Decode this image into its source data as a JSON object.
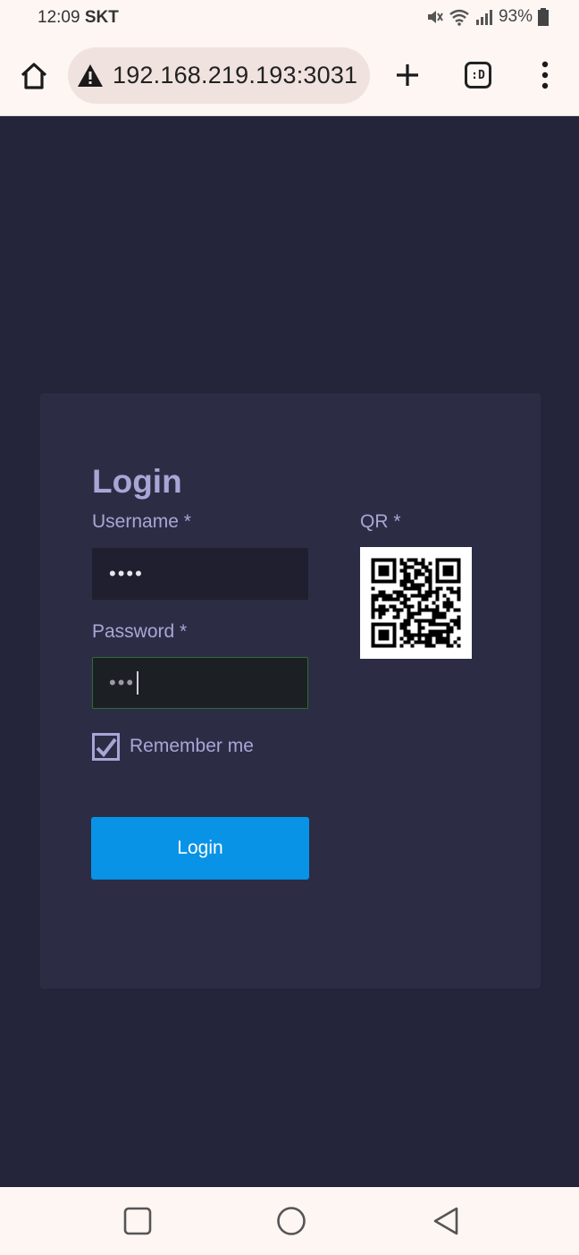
{
  "status_bar": {
    "time": "12:09",
    "carrier": "SKT",
    "battery": "93%",
    "icons": [
      "mute-icon",
      "wifi-icon",
      "signal-icon",
      "battery-icon"
    ]
  },
  "browser": {
    "url": "192.168.219.193:3031",
    "tabs_label": ":D",
    "icons": [
      "home-icon",
      "warning-icon",
      "plus-icon",
      "menu-dots-icon"
    ]
  },
  "login": {
    "title": "Login",
    "username_label": "Username *",
    "username_value": "••••",
    "password_label": "Password *",
    "password_value": "•••",
    "qr_label": "QR *",
    "remember_label": "Remember me",
    "remember_checked": true,
    "button_label": "Login"
  },
  "nav": {
    "icons": [
      "recent-apps-icon",
      "home-circle-icon",
      "back-icon"
    ]
  },
  "colors": {
    "page_bg": "#24243a",
    "card_bg": "#2c2d45",
    "accent_text": "#a9a6d6",
    "button": "#0893e6",
    "chrome_bg": "#fdf6f3"
  }
}
